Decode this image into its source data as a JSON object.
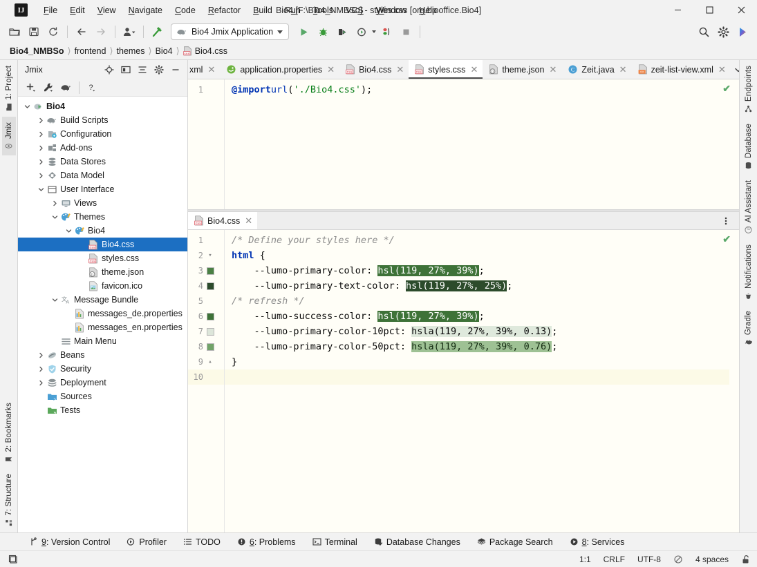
{
  "window": {
    "title": "Bio4 [F:\\Bio4_NMBSo] - styles.css [org.biooffice.Bio4]",
    "logo": "IJ",
    "minimize": "─",
    "maximize": "☐",
    "close": "✕"
  },
  "menubar": [
    {
      "label": "File"
    },
    {
      "label": "Edit"
    },
    {
      "label": "View"
    },
    {
      "label": "Navigate"
    },
    {
      "label": "Code"
    },
    {
      "label": "Refactor"
    },
    {
      "label": "Build"
    },
    {
      "label": "Run"
    },
    {
      "label": "Tools"
    },
    {
      "label": "VCS"
    },
    {
      "label": "Window"
    },
    {
      "label": "Help"
    }
  ],
  "toolbar": {
    "run_config_label": "Bio4 Jmix Application",
    "icons": [
      "open-folder-icon",
      "save-icon",
      "sync-icon",
      "back-arrow-icon",
      "forward-arrow-icon",
      "profile-icon",
      "build-hammer-icon"
    ],
    "right_icons": [
      "search-icon",
      "settings-gear-icon",
      "ai-assistant-icon"
    ]
  },
  "breadcrumb": [
    {
      "label": "Bio4_NMBSo",
      "bold": true
    },
    {
      "label": "frontend",
      "bold": false
    },
    {
      "label": "themes",
      "bold": false
    },
    {
      "label": "Bio4",
      "bold": false
    },
    {
      "label": "Bio4.css",
      "bold": false,
      "icon": "css-file-icon"
    }
  ],
  "left_strip": [
    {
      "label": "1: Project",
      "icon": "project-icon",
      "selected": false
    },
    {
      "label": "Jmix",
      "icon": "jmix-icon",
      "selected": true
    },
    {
      "label": "2: Bookmarks",
      "icon": "bookmarks-icon",
      "selected": false
    },
    {
      "label": "7: Structure",
      "icon": "structure-icon",
      "selected": false
    }
  ],
  "right_strip": [
    {
      "label": "Endpoints",
      "icon": "endpoints-icon"
    },
    {
      "label": "Database",
      "icon": "database-icon"
    },
    {
      "label": "AI Assistant",
      "icon": "ai-assistant-icon"
    },
    {
      "label": "Notifications",
      "icon": "bell-icon"
    },
    {
      "label": "Gradle",
      "icon": "gradle-elephant-icon"
    }
  ],
  "project_panel": {
    "title": "Jmix",
    "header_icons": [
      "locate-target-icon",
      "expand-window-icon",
      "collapse-all-icon",
      "gear-icon",
      "hide-icon"
    ],
    "toolbar_icons": [
      "add-plus-icon",
      "wrench-icon",
      "gradle-elephant-icon",
      "help-question-icon"
    ],
    "tree": [
      {
        "label": "Bio4",
        "depth": 0,
        "arrow": "down",
        "icon": "module-run-icon",
        "bold": true,
        "selected": false
      },
      {
        "label": "Build Scripts",
        "depth": 1,
        "arrow": "right",
        "icon": "gradle-elephant-icon",
        "bold": false,
        "selected": false
      },
      {
        "label": "Configuration",
        "depth": 1,
        "arrow": "right",
        "icon": "configuration-icon",
        "bold": false,
        "selected": false
      },
      {
        "label": "Add-ons",
        "depth": 1,
        "arrow": "right",
        "icon": "addons-icon",
        "bold": false,
        "selected": false
      },
      {
        "label": "Data Stores",
        "depth": 1,
        "arrow": "right",
        "icon": "datastore-icon",
        "bold": false,
        "selected": false
      },
      {
        "label": "Data Model",
        "depth": 1,
        "arrow": "right",
        "icon": "datamodel-icon",
        "bold": false,
        "selected": false
      },
      {
        "label": "User Interface",
        "depth": 1,
        "arrow": "down",
        "icon": "ui-window-icon",
        "bold": false,
        "selected": false
      },
      {
        "label": "Views",
        "depth": 2,
        "arrow": "right",
        "icon": "views-monitor-icon",
        "bold": false,
        "selected": false
      },
      {
        "label": "Themes",
        "depth": 2,
        "arrow": "down",
        "icon": "theme-palette-icon",
        "bold": false,
        "selected": false
      },
      {
        "label": "Bio4",
        "depth": 3,
        "arrow": "down",
        "icon": "theme-palette-icon",
        "bold": false,
        "selected": false
      },
      {
        "label": "Bio4.css",
        "depth": 4,
        "arrow": "none",
        "icon": "css-file-icon",
        "bold": false,
        "selected": true
      },
      {
        "label": "styles.css",
        "depth": 4,
        "arrow": "none",
        "icon": "css-file-icon",
        "bold": false,
        "selected": false
      },
      {
        "label": "theme.json",
        "depth": 4,
        "arrow": "none",
        "icon": "json-file-icon",
        "bold": false,
        "selected": false
      },
      {
        "label": "favicon.ico",
        "depth": 4,
        "arrow": "none",
        "icon": "image-file-icon",
        "bold": false,
        "selected": false
      },
      {
        "label": "Message Bundle",
        "depth": 2,
        "arrow": "down",
        "icon": "translate-icon",
        "bold": false,
        "selected": false
      },
      {
        "label": "messages_de.properties",
        "depth": 3,
        "arrow": "none",
        "icon": "properties-file-icon",
        "bold": false,
        "selected": false
      },
      {
        "label": "messages_en.properties",
        "depth": 3,
        "arrow": "none",
        "icon": "properties-file-icon",
        "bold": false,
        "selected": false
      },
      {
        "label": "Main Menu",
        "depth": 2,
        "arrow": "none",
        "icon": "menu-lines-icon",
        "bold": false,
        "selected": false
      },
      {
        "label": "Beans",
        "depth": 1,
        "arrow": "right",
        "icon": "beans-icon",
        "bold": false,
        "selected": false
      },
      {
        "label": "Security",
        "depth": 1,
        "arrow": "right",
        "icon": "security-shield-icon",
        "bold": false,
        "selected": false
      },
      {
        "label": "Deployment",
        "depth": 1,
        "arrow": "right",
        "icon": "deployment-icon",
        "bold": false,
        "selected": false
      },
      {
        "label": "Sources",
        "depth": 1,
        "arrow": "none",
        "icon": "sources-folder-icon",
        "bold": false,
        "selected": false
      },
      {
        "label": "Tests",
        "depth": 1,
        "arrow": "none",
        "icon": "tests-folder-icon",
        "bold": false,
        "selected": false
      }
    ]
  },
  "editor_tabs": [
    {
      "label": "xml",
      "icon": "xml-file-icon",
      "active": false,
      "clipped": true
    },
    {
      "label": "application.properties",
      "icon": "spring-properties-icon",
      "active": false
    },
    {
      "label": "Bio4.css",
      "icon": "css-file-icon",
      "active": false
    },
    {
      "label": "styles.css",
      "icon": "css-file-icon",
      "active": true
    },
    {
      "label": "theme.json",
      "icon": "json-file-icon",
      "active": false
    },
    {
      "label": "Zeit.java",
      "icon": "java-class-icon",
      "active": false
    },
    {
      "label": "zeit-list-view.xml",
      "icon": "view-xml-icon",
      "active": false
    }
  ],
  "top_editor": {
    "lines": [
      {
        "num": "1",
        "text": "@import url('./Bio4.css');"
      }
    ],
    "inspection_status": "✔"
  },
  "split_editor": {
    "tab": {
      "label": "Bio4.css",
      "icon": "css-file-icon"
    },
    "inspection_status": "✔",
    "lines": [
      {
        "num": "1",
        "text": "/* Define your styles here */"
      },
      {
        "num": "2",
        "text": "html {"
      },
      {
        "num": "3",
        "text": "    --lumo-primary-color: hsl(119, 27%, 39%);",
        "swatch": "#4a8044"
      },
      {
        "num": "4",
        "text": "    --lumo-primary-text-color: hsl(119, 27%, 25%);",
        "swatch": "#2c4b2b"
      },
      {
        "num": "5",
        "text": "    /* refresh */"
      },
      {
        "num": "6",
        "text": "    --lumo-success-color: hsl(119, 27%, 39%);",
        "swatch": "#4a8044"
      },
      {
        "num": "7",
        "text": "    --lumo-primary-color-10pct: hsla(119, 27%, 39%, 0.13);",
        "swatch": "#dde6da"
      },
      {
        "num": "8",
        "text": "    --lumo-primary-color-50pct: hsla(119, 27%, 39%, 0.76);",
        "swatch": "#71a368"
      },
      {
        "num": "9",
        "text": "}"
      },
      {
        "num": "10",
        "text": ""
      }
    ]
  },
  "bottom_bar": [
    {
      "label": "9: Version Control",
      "icon": "branch-icon",
      "mnemonic": "9"
    },
    {
      "label": "Profiler",
      "icon": "profiler-icon"
    },
    {
      "label": "TODO",
      "icon": "todo-list-icon"
    },
    {
      "label": "6: Problems",
      "icon": "problems-warning-icon",
      "mnemonic": "6"
    },
    {
      "label": "Terminal",
      "icon": "terminal-icon"
    },
    {
      "label": "Database Changes",
      "icon": "database-changes-icon"
    },
    {
      "label": "Package Search",
      "icon": "package-search-icon"
    },
    {
      "label": "8: Services",
      "icon": "services-play-icon",
      "mnemonic": "8"
    }
  ],
  "status_bar": {
    "caret": "1:1",
    "line_sep": "CRLF",
    "encoding": "UTF-8",
    "read_only_icon": "no-edit-icon",
    "indent": "4 spaces",
    "lock_icon": "lock-open-icon"
  },
  "colors": {
    "accent_green": "#59a869",
    "selection_blue": "#1c6fc2",
    "editor_bg": "#fffef7",
    "panel_bg": "#f2f2f2"
  }
}
